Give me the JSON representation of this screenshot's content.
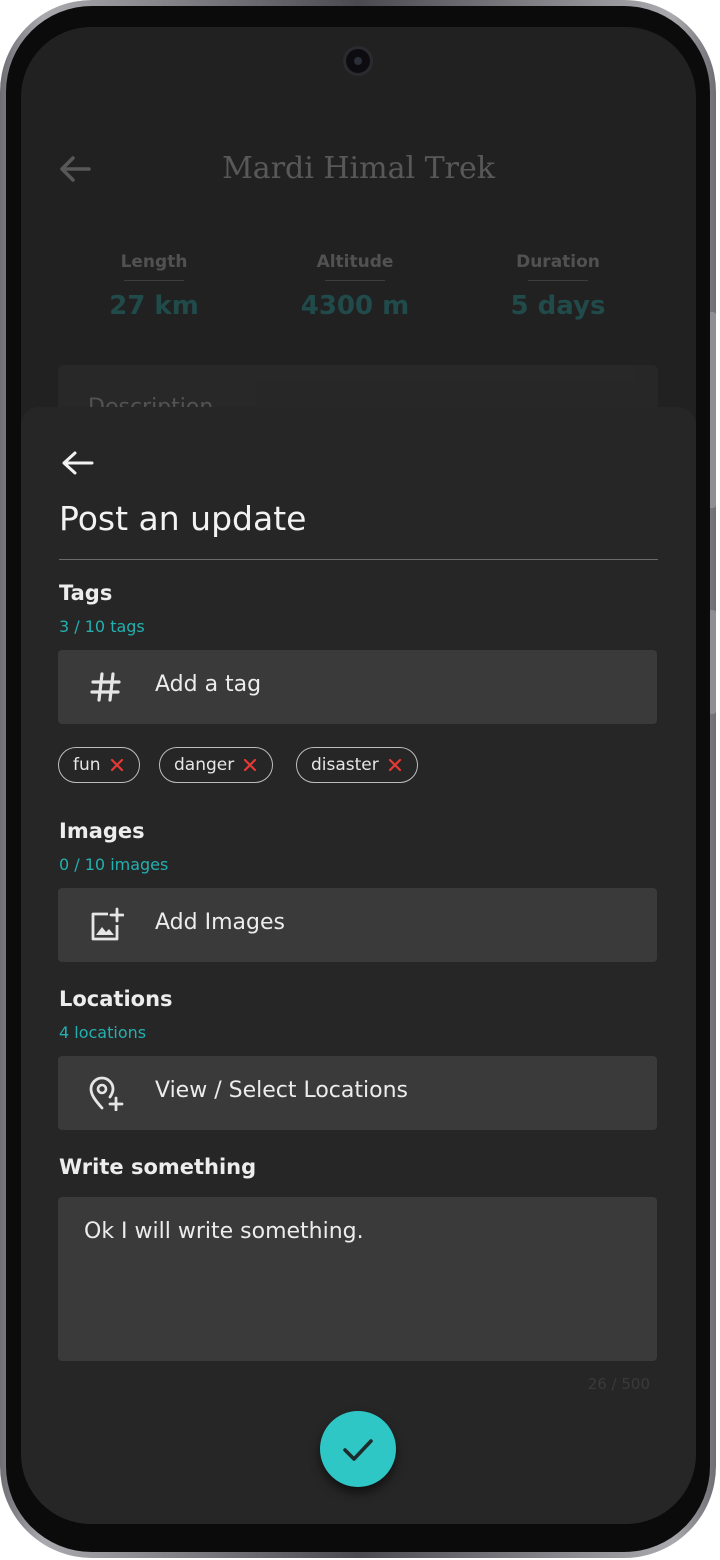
{
  "background_page": {
    "title": "Mardi Himal Trek",
    "stats": [
      {
        "label": "Length",
        "value": "27 km"
      },
      {
        "label": "Altitude",
        "value": "4300 m"
      },
      {
        "label": "Duration",
        "value": "5 days"
      }
    ],
    "card_text": "Description"
  },
  "sheet": {
    "title": "Post an update",
    "tags": {
      "title": "Tags",
      "count": "3 / 10 tags",
      "add_label": "Add a tag",
      "icon": "hashtag-icon",
      "chips": [
        "fun",
        "danger",
        "disaster"
      ]
    },
    "images": {
      "title": "Images",
      "count": "0 / 10 images",
      "add_label": "Add Images",
      "icon": "add-photo-icon"
    },
    "locations": {
      "title": "Locations",
      "count": "4 locations",
      "add_label": "View / Select Locations",
      "icon": "add-location-icon"
    },
    "write": {
      "title": "Write something",
      "value": "Ok I will write something.",
      "counter": "26 / 500"
    }
  },
  "colors": {
    "accent": "#2fc6c6",
    "count_text": "#23b0b0",
    "chip_remove": "#e53935",
    "sheet_bg": "#262626",
    "field_bg": "#3a3a3a"
  }
}
